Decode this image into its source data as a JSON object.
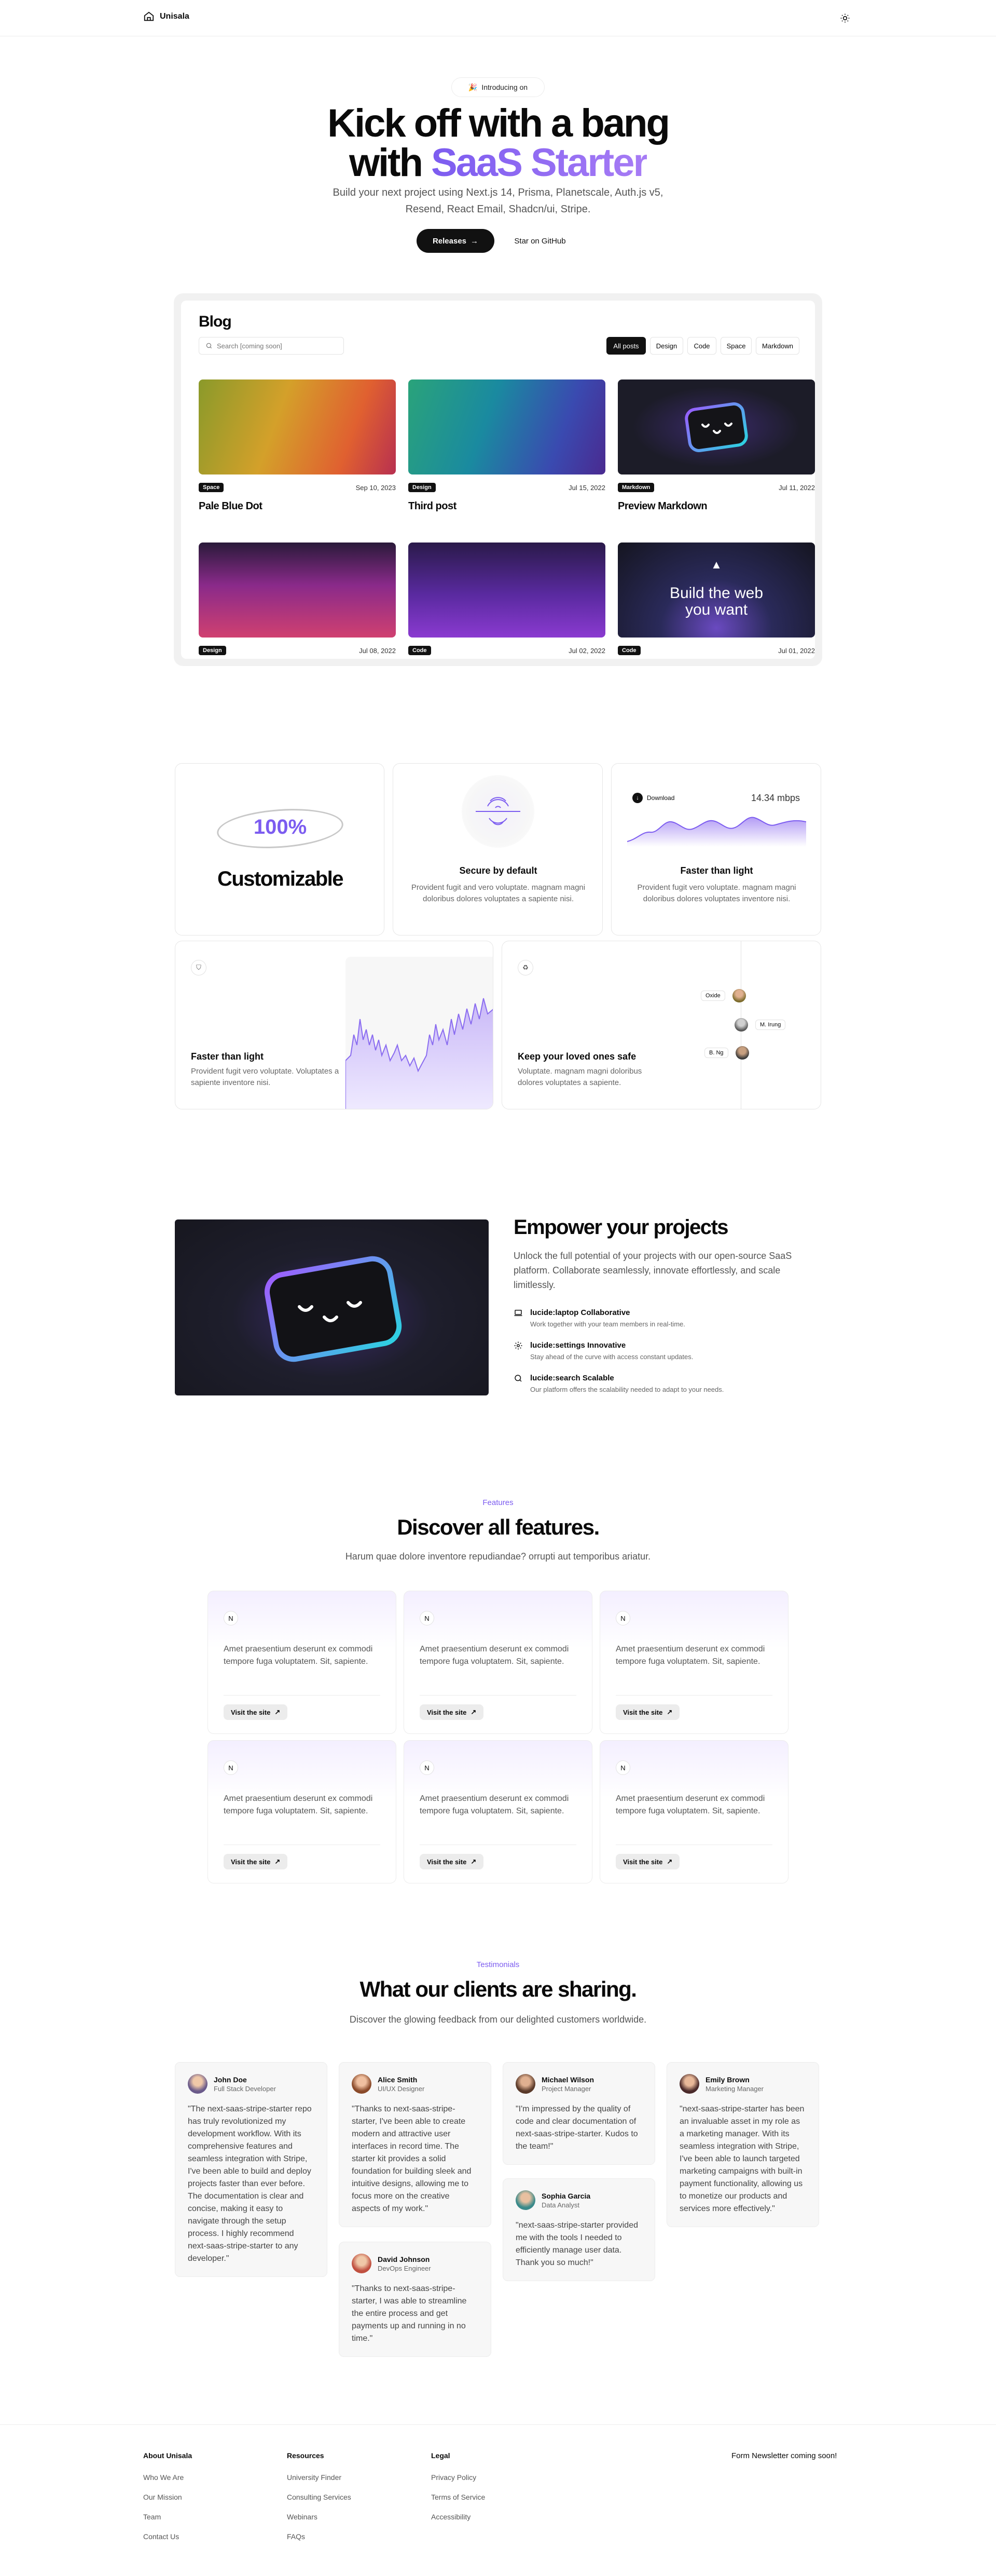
{
  "header": {
    "brand": "Unisala"
  },
  "hero": {
    "badge": "Introducing on",
    "title_line1": "Kick off with a bang",
    "title_line2_plain": "with ",
    "title_line2_grad": "SaaS Starter",
    "subtitle": "Build your next project using Next.js 14, Prisma, Planetscale, Auth.js v5, Resend, React Email, Shadcn/ui, Stripe.",
    "releases_label": "Releases",
    "github_label": "Star on GitHub"
  },
  "blog": {
    "title": "Blog",
    "search_placeholder": "Search [coming soon]",
    "filters": [
      "All posts",
      "Design",
      "Code",
      "Space",
      "Markdown"
    ],
    "posts": [
      {
        "tag": "Space",
        "date": "Sep 10, 2023",
        "title": "Pale Blue Dot"
      },
      {
        "tag": "Design",
        "date": "Jul 15, 2022",
        "title": "Third post"
      },
      {
        "tag": "Markdown",
        "date": "Jul 11, 2022",
        "title": "Preview Markdown"
      },
      {
        "tag": "Design",
        "date": "Jul 08, 2022",
        "title": ""
      },
      {
        "tag": "Code",
        "date": "Jul 02, 2022",
        "title": ""
      },
      {
        "tag": "Code",
        "date": "Jul 01, 2022",
        "title": ""
      }
    ],
    "post6_overlay": "Build the web you want"
  },
  "bento": {
    "percent": "100%",
    "customizable": "Customizable",
    "secure_title": "Secure by default",
    "secure_desc": "Provident fugit and vero voluptate. magnam magni doloribus dolores voluptates a sapiente nisi.",
    "light_title": "Faster than light",
    "light_desc": "Provident fugit vero voluptate. magnam magni doloribus dolores voluptates inventore nisi.",
    "download_label": "Download",
    "download_speed": "14.34 mbps",
    "fast_title": "Faster than light",
    "fast_desc": "Provident fugit vero voluptate. Voluptates a sapiente inventore nisi.",
    "safe_title": "Keep your loved ones safe",
    "safe_desc": "Voluptate. magnam magni doloribus dolores voluptates a sapiente.",
    "people": [
      "Oxide",
      "M. Irung",
      "B. Ng"
    ]
  },
  "empower": {
    "title": "Empower your projects",
    "text": "Unlock the full potential of your projects with our open-source SaaS platform. Collaborate seamlessly, innovate effortlessly, and scale limitlessly.",
    "features": [
      {
        "icon": "laptop-icon",
        "title": "lucide:laptop Collaborative",
        "desc": "Work together with your team members in real-time."
      },
      {
        "icon": "settings-icon",
        "title": "lucide:settings Innovative",
        "desc": "Stay ahead of the curve with access constant updates."
      },
      {
        "icon": "search-icon",
        "title": "lucide:search Scalable",
        "desc": "Our platform offers the scalability needed to adapt to your needs."
      }
    ]
  },
  "features": {
    "eyebrow": "Features",
    "title": "Discover all features.",
    "subtitle": "Harum quae dolore inventore repudiandae? orrupti aut temporibus ariatur.",
    "card_text": "Amet praesentium deserunt ex commodi tempore fuga voluptatem. Sit, sapiente.",
    "card_button": "Visit the site"
  },
  "testimonials": {
    "eyebrow": "Testimonials",
    "title": "What our clients are sharing.",
    "subtitle": "Discover the glowing feedback from our delighted customers worldwide.",
    "items": [
      {
        "name": "John Doe",
        "role": "Full Stack Developer",
        "quote": "\"The next-saas-stripe-starter repo has truly revolutionized my development workflow. With its comprehensive features and seamless integration with Stripe, I've been able to build and deploy projects faster than ever before. The documentation is clear and concise, making it easy to navigate through the setup process. I highly recommend next-saas-stripe-starter to any developer.\""
      },
      {
        "name": "Alice Smith",
        "role": "UI/UX Designer",
        "quote": "\"Thanks to next-saas-stripe-starter, I've been able to create modern and attractive user interfaces in record time. The starter kit provides a solid foundation for building sleek and intuitive designs, allowing me to focus more on the creative aspects of my work.\""
      },
      {
        "name": "David Johnson",
        "role": "DevOps Engineer",
        "quote": "\"Thanks to next-saas-stripe-starter, I was able to streamline the entire process and get payments up and running in no time.\""
      },
      {
        "name": "Michael Wilson",
        "role": "Project Manager",
        "quote": "\"I'm impressed by the quality of code and clear documentation of next-saas-stripe-starter. Kudos to the team!\""
      },
      {
        "name": "Sophia Garcia",
        "role": "Data Analyst",
        "quote": "\"next-saas-stripe-starter provided me with the tools I needed to efficiently manage user data. Thank you so much!\""
      },
      {
        "name": "Emily Brown",
        "role": "Marketing Manager",
        "quote": "\"next-saas-stripe-starter has been an invaluable asset in my role as a marketing manager. With its seamless integration with Stripe, I've been able to launch targeted marketing campaigns with built-in payment functionality, allowing us to monetize our products and services more effectively.\""
      }
    ]
  },
  "footer": {
    "cols": [
      {
        "title": "About Unisala",
        "links": [
          "Who We Are",
          "Our Mission",
          "Team",
          "Contact Us"
        ]
      },
      {
        "title": "Resources",
        "links": [
          "University Finder",
          "Consulting Services",
          "Webinars",
          "FAQs"
        ]
      },
      {
        "title": "Legal",
        "links": [
          "Privacy Policy",
          "Terms of Service",
          "Accessibility"
        ]
      }
    ],
    "newsletter": "Form Newsletter coming soon!"
  },
  "colors": {
    "accent": "#7c5cf0",
    "dark": "#111111"
  }
}
